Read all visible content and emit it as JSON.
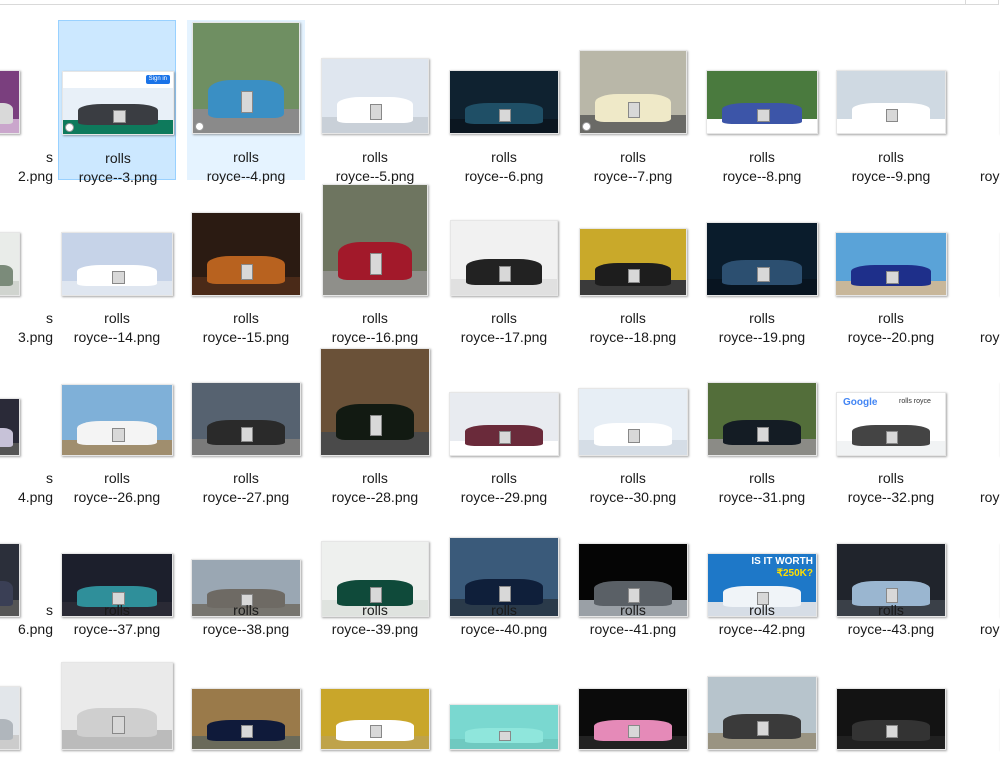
{
  "file_label_prefix": "rolls",
  "files": [
    {
      "line2": "2.png",
      "bg": "#7a3f7e",
      "car": "#d9d9d9",
      "ground": "#caa6cc"
    },
    {
      "line2": "royce--3.png",
      "bg": "#e8f0f8",
      "car": "#3a3d42",
      "ground": "#0e7a5c",
      "selected": true
    },
    {
      "line2": "royce--4.png",
      "bg": "#6f8f62",
      "car": "#3a8fc4",
      "ground": "#8a8a8a",
      "hover": true
    },
    {
      "line2": "royce--5.png",
      "bg": "#dfe6ef",
      "car": "#ffffff",
      "ground": "#c9d0d8"
    },
    {
      "line2": "royce--6.png",
      "bg": "#0f2230",
      "car": "#1f4f66",
      "ground": "#0b1620"
    },
    {
      "line2": "royce--7.png",
      "bg": "#b9b7a8",
      "car": "#efe9c8",
      "ground": "#6a6a66"
    },
    {
      "line2": "royce--8.png",
      "bg": "#4a7a3e",
      "car": "#3c55a8",
      "ground": "#ffffff"
    },
    {
      "line2": "royce--9.png",
      "bg": "#cfd9e2",
      "car": "#ffffff",
      "ground": "#ffffff"
    },
    {
      "line2": "roy",
      "bg": "#222222",
      "car": "#c9a23a",
      "ground": "#fff"
    },
    {
      "line2": "3.png",
      "bg": "#e9ece9",
      "car": "#7b8b7a",
      "ground": "#d0d4cf"
    },
    {
      "line2": "royce--14.png",
      "bg": "#c6d3e8",
      "car": "#ffffff",
      "ground": "#dfe6f0"
    },
    {
      "line2": "royce--15.png",
      "bg": "#2b1b12",
      "car": "#b8621f",
      "ground": "#4a2a18"
    },
    {
      "line2": "royce--16.png",
      "bg": "#6e7560",
      "car": "#a2192a",
      "ground": "#8f8f8a"
    },
    {
      "line2": "royce--17.png",
      "bg": "#f1f1f1",
      "car": "#222222",
      "ground": "#e0e0e0"
    },
    {
      "line2": "royce--18.png",
      "bg": "#c9a92a",
      "car": "#1d1d1d",
      "ground": "#3a3a3a"
    },
    {
      "line2": "royce--19.png",
      "bg": "#0a1c2c",
      "car": "#2c4f70",
      "ground": "#081420"
    },
    {
      "line2": "royce--20.png",
      "bg": "#5aa3d8",
      "car": "#1e2f8a",
      "ground": "#c8b79a"
    },
    {
      "line2": "roy",
      "bg": "#6b8a4e",
      "car": "#8a1a2a",
      "ground": "#777"
    },
    {
      "line2": "4.png",
      "bg": "#2a2a38",
      "car": "#c7c2d8",
      "ground": "#555"
    },
    {
      "line2": "royce--26.png",
      "bg": "#7fb0d8",
      "car": "#f4f4f4",
      "ground": "#a08e6e"
    },
    {
      "line2": "royce--27.png",
      "bg": "#566270",
      "car": "#2a2a2a",
      "ground": "#7a7a7a"
    },
    {
      "line2": "royce--28.png",
      "bg": "#6a5138",
      "car": "#121a12",
      "ground": "#4a4a4a"
    },
    {
      "line2": "royce--29.png",
      "bg": "#e8ebf0",
      "car": "#6a2a3a",
      "ground": "#ffffff"
    },
    {
      "line2": "royce--30.png",
      "bg": "#e7eef5",
      "car": "#ffffff",
      "ground": "#d5dde6"
    },
    {
      "line2": "royce--31.png",
      "bg": "#536e3a",
      "car": "#141c24",
      "ground": "#8b8b86"
    },
    {
      "line2": "royce--32.png",
      "bg": "#ffffff",
      "car": "#444444",
      "ground": "#f1f3f4",
      "google": true
    },
    {
      "line2": "roy",
      "bg": "#3a4a3a",
      "car": "#b9c0c8",
      "ground": "#666"
    },
    {
      "line2": "6.png",
      "bg": "#2b2f3a",
      "car": "#3a3f55",
      "ground": "#555"
    },
    {
      "line2": "royce--37.png",
      "bg": "#1c1f2c",
      "car": "#2f8f9a",
      "ground": "#2a2a35"
    },
    {
      "line2": "royce--38.png",
      "bg": "#9aa7b3",
      "car": "#6e6a64",
      "ground": "#77756f"
    },
    {
      "line2": "royce--39.png",
      "bg": "#eef0ee",
      "car": "#0f4a3a",
      "ground": "#dfe3df"
    },
    {
      "line2": "royce--40.png",
      "bg": "#3a5a7a",
      "car": "#0f1f3a",
      "ground": "#2a3a4a"
    },
    {
      "line2": "royce--41.png",
      "bg": "#050505",
      "car": "#5a6066",
      "ground": "#9aa0a6"
    },
    {
      "line2": "royce--42.png",
      "bg": "#1e78c8",
      "car": "#f0f4f8",
      "ground": "#d6dde6",
      "headline": true
    },
    {
      "line2": "royce--43.png",
      "bg": "#20242c",
      "car": "#9ab6d0",
      "ground": "#3a4048"
    },
    {
      "line2": "roy",
      "bg": "#1c2438",
      "car": "#2f3f6a",
      "ground": "#555"
    },
    {
      "line2": "",
      "bg": "#e2e6ea",
      "car": "#b0b6bc",
      "ground": "#ccc"
    },
    {
      "line2": "",
      "bg": "#eaeaea",
      "car": "#cfcfcf",
      "ground": "#bbb"
    },
    {
      "line2": "",
      "bg": "#9a7a4a",
      "car": "#0f1a3a",
      "ground": "#6a6a5a"
    },
    {
      "line2": "",
      "bg": "#c9a62a",
      "car": "#ffffff",
      "ground": "#bfa34a"
    },
    {
      "line2": "",
      "bg": "#7ad8d0",
      "car": "#8fe6dc",
      "ground": "#6fc9c0"
    },
    {
      "line2": "",
      "bg": "#0b0b0b",
      "car": "#e58ab8",
      "ground": "#222"
    },
    {
      "line2": "",
      "bg": "#b7c4cc",
      "car": "#3a3a3a",
      "ground": "#9a9482"
    },
    {
      "line2": "",
      "bg": "#131313",
      "car": "#333333",
      "ground": "#202020"
    },
    {
      "line2": "",
      "bg": "#e8e8e8",
      "car": "#2a2a2a",
      "ground": "#ccc"
    }
  ],
  "overlay_texts": {
    "sign_in": "Sign in",
    "google": "Google",
    "google_query": "rolls royce",
    "headline_1": "IS IT WORTH",
    "headline_2": "₹250K?"
  }
}
